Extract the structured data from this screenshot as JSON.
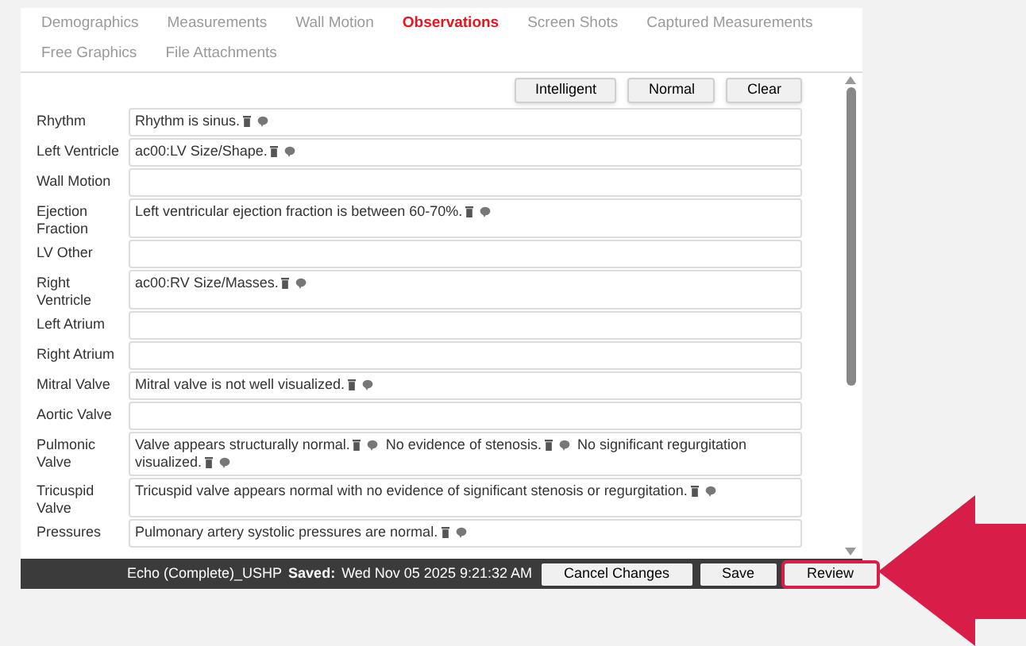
{
  "tabs": [
    {
      "label": "Demographics",
      "selected": false
    },
    {
      "label": "Measurements",
      "selected": false
    },
    {
      "label": "Wall Motion",
      "selected": false
    },
    {
      "label": "Observations",
      "selected": true
    },
    {
      "label": "Screen Shots",
      "selected": false
    },
    {
      "label": "Captured Measurements",
      "selected": false
    },
    {
      "label": "Free Graphics",
      "selected": false
    },
    {
      "label": "File Attachments",
      "selected": false
    }
  ],
  "toolbar_buttons": [
    "Intelligent",
    "Normal",
    "Clear"
  ],
  "observations": [
    {
      "label": "Rhythm",
      "sentences": [
        "Rhythm is sinus."
      ]
    },
    {
      "label": "Left Ventricle",
      "sentences": [
        "ac00:LV Size/Shape."
      ]
    },
    {
      "label": "Wall Motion"
    },
    {
      "label": "Ejection Fraction",
      "sentences": [
        "Left ventricular ejection fraction is between 60-70%."
      ]
    },
    {
      "label": "LV Other"
    },
    {
      "label": "Right Ventricle",
      "sentences": [
        "ac00:RV Size/Masses."
      ]
    },
    {
      "label": "Left Atrium"
    },
    {
      "label": "Right Atrium"
    },
    {
      "label": "Mitral Valve",
      "sentences": [
        "Mitral valve is not well visualized."
      ]
    },
    {
      "label": "Aortic Valve"
    },
    {
      "label": "Pulmonic Valve",
      "sentences": [
        "Valve appears structurally normal.",
        "No evidence of stenosis.",
        "No significant regurgitation visualized."
      ]
    },
    {
      "label": "Tricuspid Valve",
      "sentences": [
        "Tricuspid valve appears normal with no evidence of significant stenosis or regurgitation."
      ]
    },
    {
      "label": "Pressures",
      "sentences": [
        "Pulmonary artery systolic pressures are normal."
      ]
    }
  ],
  "footer": {
    "document": "Echo (Complete)_USHP",
    "saved_label": "Saved:",
    "saved_time": "Wed Nov 05 2025 9:21:32 AM",
    "buttons": [
      {
        "label": "Cancel Changes",
        "highlighted": false
      },
      {
        "label": "Save",
        "highlighted": false
      },
      {
        "label": "Review",
        "highlighted": true
      }
    ]
  }
}
